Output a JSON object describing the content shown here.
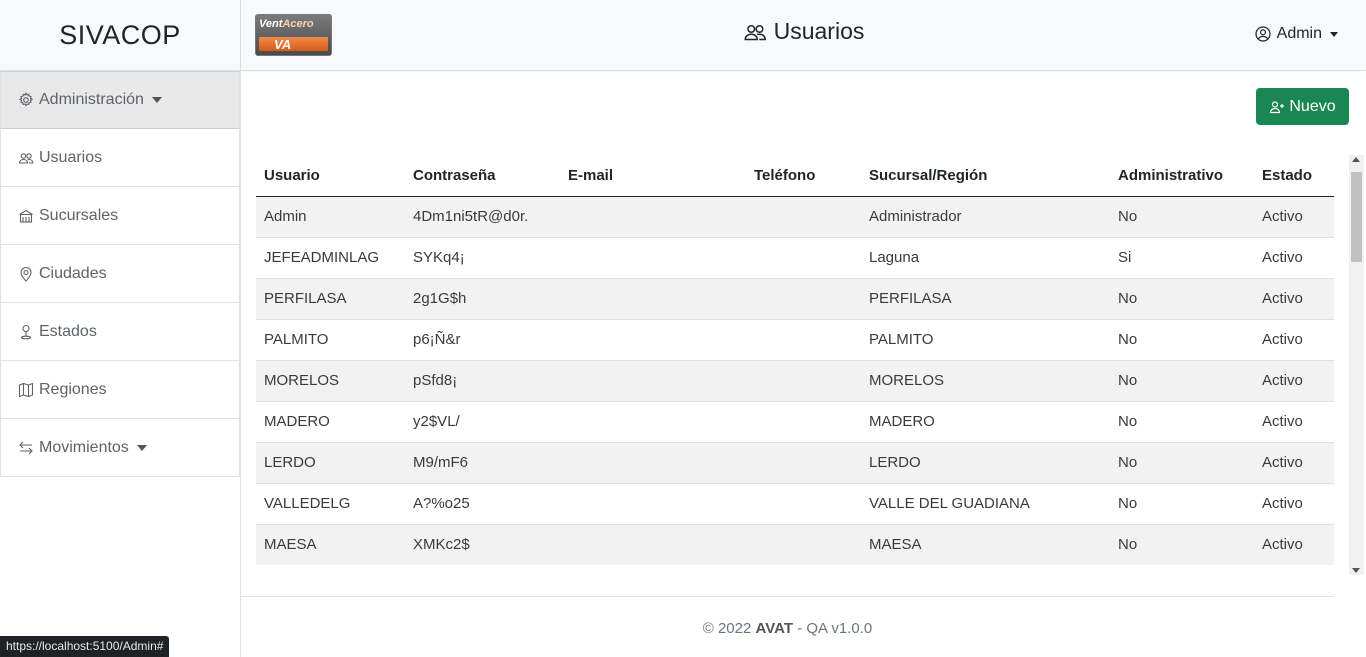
{
  "brand": "SIVACOP",
  "logo": {
    "text_a": "Vent",
    "text_b": "Acero",
    "mark": "VA"
  },
  "header": {
    "title": "Usuarios",
    "user": "Admin"
  },
  "sidebar": {
    "items": [
      {
        "label": "Administración",
        "icon": "gear-icon",
        "active": true,
        "dropdown": true
      },
      {
        "label": "Usuarios",
        "icon": "people-icon"
      },
      {
        "label": "Sucursales",
        "icon": "building-icon"
      },
      {
        "label": "Ciudades",
        "icon": "geo-pin-icon"
      },
      {
        "label": "Estados",
        "icon": "person-pin-icon"
      },
      {
        "label": "Regiones",
        "icon": "map-icon"
      },
      {
        "label": "Movimientos",
        "icon": "arrows-icon",
        "dropdown": true
      }
    ]
  },
  "actions": {
    "new_label": "Nuevo"
  },
  "table": {
    "columns": [
      "Usuario",
      "Contraseña",
      "E-mail",
      "Teléfono",
      "Sucursal/Región",
      "Administrativo",
      "Estado"
    ],
    "rows": [
      [
        "Admin",
        "4Dm1ni5tR@d0r.",
        "",
        "",
        "Administrador",
        "No",
        "Activo"
      ],
      [
        "JEFEADMINLAG",
        "SYKq4¡",
        "",
        "",
        "Laguna",
        "Si",
        "Activo"
      ],
      [
        "PERFILASA",
        "2g1G$h",
        "",
        "",
        "PERFILASA",
        "No",
        "Activo"
      ],
      [
        "PALMITO",
        "p6¡Ñ&r",
        "",
        "",
        "PALMITO",
        "No",
        "Activo"
      ],
      [
        "MORELOS",
        "pSfd8¡",
        "",
        "",
        "MORELOS",
        "No",
        "Activo"
      ],
      [
        "MADERO",
        "y2$VL/",
        "",
        "",
        "MADERO",
        "No",
        "Activo"
      ],
      [
        "LERDO",
        "M9/mF6",
        "",
        "",
        "LERDO",
        "No",
        "Activo"
      ],
      [
        "VALLEDELG",
        "A?%o25",
        "",
        "",
        "VALLE DEL GUADIANA",
        "No",
        "Activo"
      ],
      [
        "MAESA",
        "XMKc2$",
        "",
        "",
        "MAESA",
        "No",
        "Activo"
      ]
    ]
  },
  "footer": {
    "copy": "© 2022",
    "org": "AVAT",
    "env": "- QA v1.0.0"
  },
  "status_url": "https://localhost:5100/Admin#",
  "colors": {
    "primary_green": "#198754",
    "sidebar_active": "#e9e9e9",
    "stripe": "#f2f2f2"
  }
}
